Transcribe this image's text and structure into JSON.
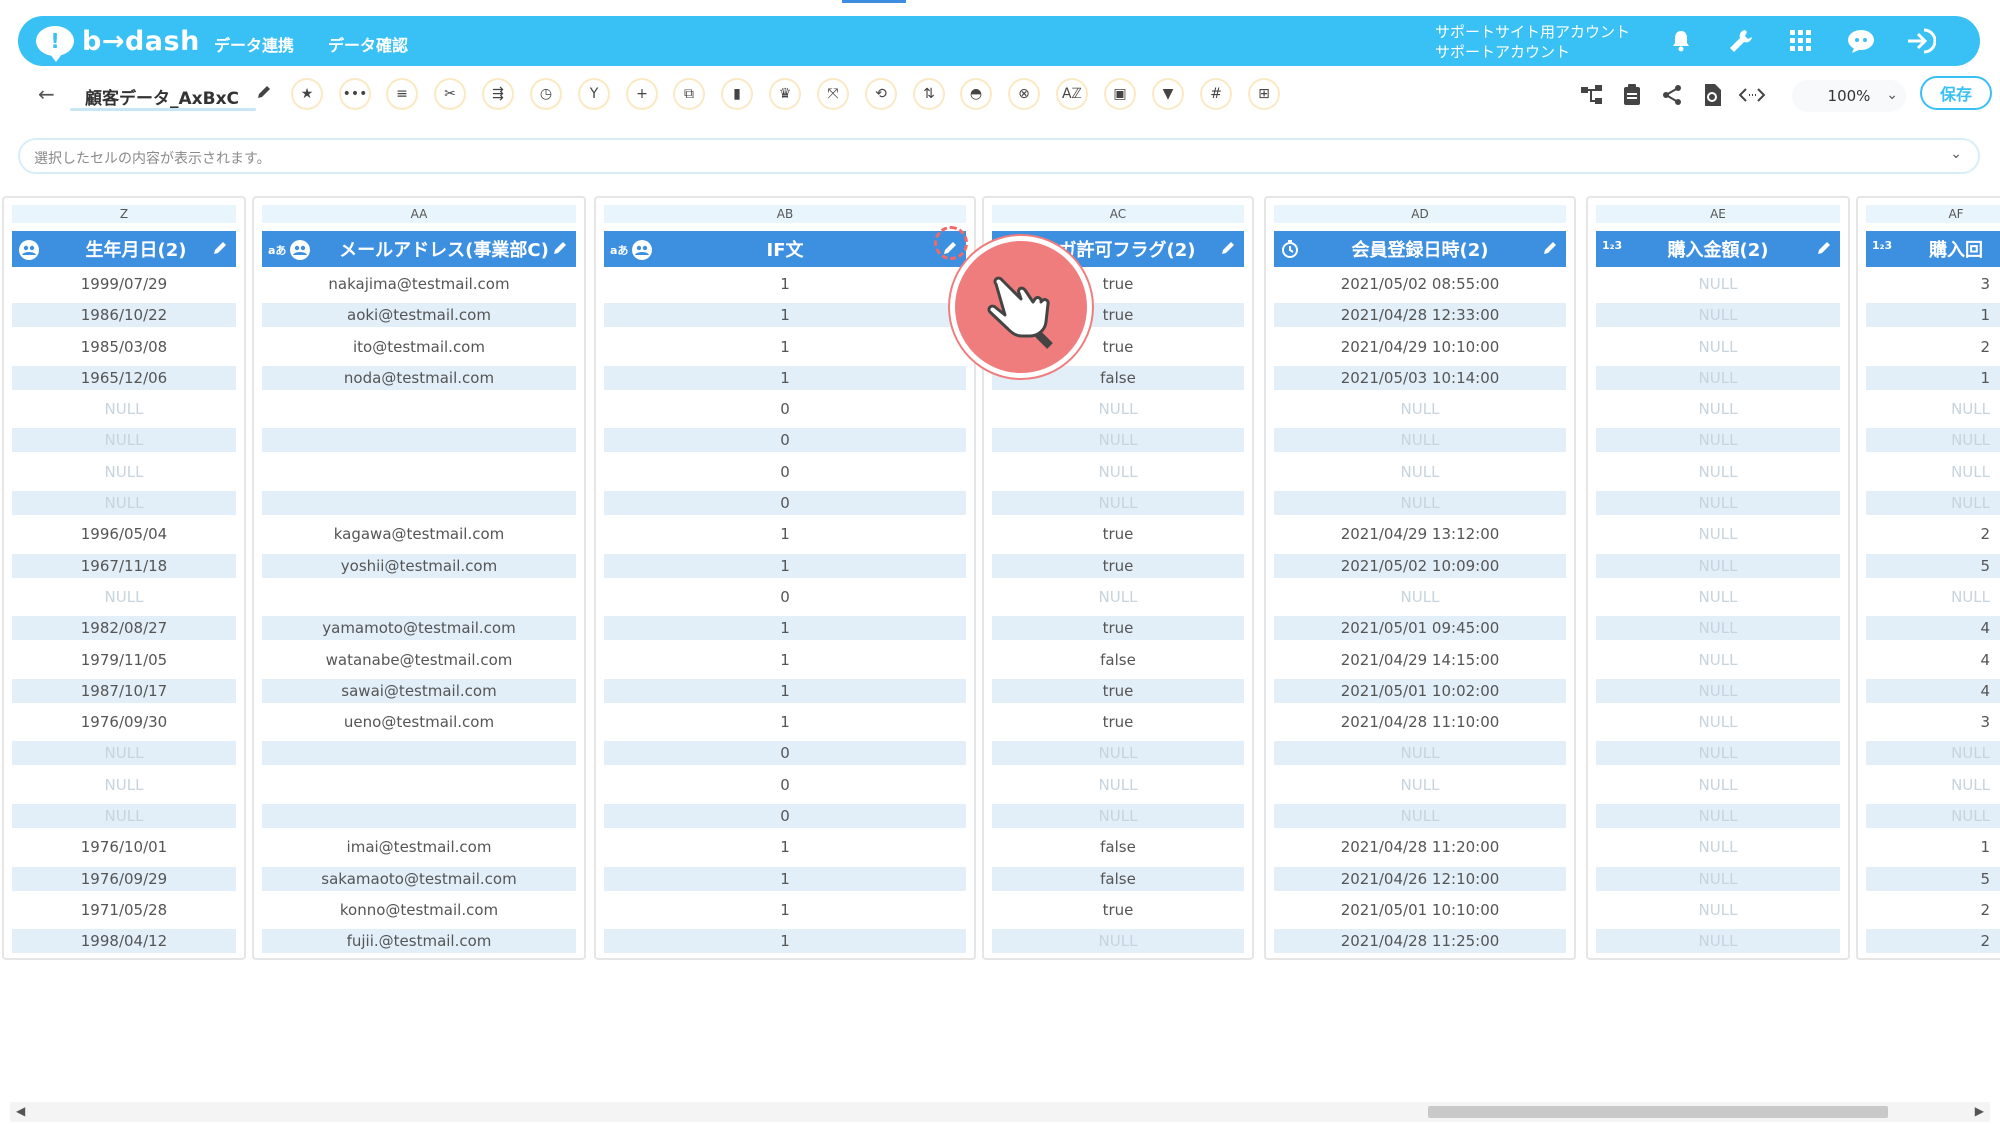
{
  "header": {
    "logo_text": "b→dash",
    "logo_mark": "!",
    "nav": [
      "データ連携",
      "データ確認"
    ],
    "account_line1": "サポートサイト用アカウント",
    "account_line2": "サポートアカウント"
  },
  "toolbar": {
    "table_name": "顧客データ_AxBxC",
    "zoom": "100%",
    "save_label": "保存"
  },
  "cellbar": {
    "placeholder": "選択したセルの内容が表示されます。"
  },
  "columns": [
    {
      "letter": "Z",
      "title": "生年月日(2)",
      "type_icon": "people-icon",
      "cells": [
        "1999/07/29",
        "1986/10/22",
        "1985/03/08",
        "1965/12/06",
        "NULL",
        "NULL",
        "NULL",
        "NULL",
        "1996/05/04",
        "1967/11/18",
        "NULL",
        "1982/08/27",
        "1979/11/05",
        "1987/10/17",
        "1976/09/30",
        "NULL",
        "NULL",
        "NULL",
        "1976/10/01",
        "1976/09/29",
        "1971/05/28",
        "1998/04/12"
      ]
    },
    {
      "letter": "AA",
      "title": "メールアドレス(事業部C)",
      "type_icon": "text-people-icon",
      "type_prefix": "aあ",
      "cells": [
        "nakajima@testmail.com",
        "aoki@testmail.com",
        "ito@testmail.com",
        "noda@testmail.com",
        "",
        "",
        "",
        "",
        "kagawa@testmail.com",
        "yoshii@testmail.com",
        "",
        "yamamoto@testmail.com",
        "watanabe@testmail.com",
        "sawai@testmail.com",
        "ueno@testmail.com",
        "",
        "",
        "",
        "imai@testmail.com",
        "sakamaoto@testmail.com",
        "konno@testmail.com",
        "fujii.@testmail.com"
      ]
    },
    {
      "letter": "AB",
      "title": "IF文",
      "type_icon": "text-people-icon",
      "type_prefix": "aあ",
      "cells": [
        "1",
        "1",
        "1",
        "1",
        "0",
        "0",
        "0",
        "0",
        "1",
        "1",
        "0",
        "1",
        "1",
        "1",
        "1",
        "0",
        "0",
        "0",
        "1",
        "1",
        "1",
        "1"
      ]
    },
    {
      "letter": "AC",
      "title": "マガ許可フラグ(2)",
      "type_icon": "",
      "cells": [
        "true",
        "true",
        "true",
        "false",
        "NULL",
        "NULL",
        "NULL",
        "NULL",
        "true",
        "true",
        "NULL",
        "true",
        "false",
        "true",
        "true",
        "NULL",
        "NULL",
        "NULL",
        "false",
        "false",
        "true",
        "NULL"
      ]
    },
    {
      "letter": "AD",
      "title": "会員登録日時(2)",
      "type_icon": "clock-icon",
      "cells": [
        "2021/05/02 08:55:00",
        "2021/04/28 12:33:00",
        "2021/04/29 10:10:00",
        "2021/05/03 10:14:00",
        "NULL",
        "NULL",
        "NULL",
        "NULL",
        "2021/04/29 13:12:00",
        "2021/05/02 10:09:00",
        "NULL",
        "2021/05/01 09:45:00",
        "2021/04/29 14:15:00",
        "2021/05/01 10:02:00",
        "2021/04/28 11:10:00",
        "NULL",
        "NULL",
        "NULL",
        "2021/04/28 11:20:00",
        "2021/04/26 12:10:00",
        "2021/05/01 10:10:00",
        "2021/04/28 11:25:00"
      ]
    },
    {
      "letter": "AE",
      "title": "購入金額(2)",
      "type_icon": "number-icon",
      "type_prefix": "1₂3",
      "cells": [
        "NULL",
        "NULL",
        "NULL",
        "NULL",
        "NULL",
        "NULL",
        "NULL",
        "NULL",
        "NULL",
        "NULL",
        "NULL",
        "NULL",
        "NULL",
        "NULL",
        "NULL",
        "NULL",
        "NULL",
        "NULL",
        "NULL",
        "NULL",
        "NULL",
        "NULL"
      ]
    },
    {
      "letter": "AF",
      "title": "購入回",
      "type_icon": "number-icon",
      "type_prefix": "1₂3",
      "cells": [
        "3",
        "1",
        "2",
        "1",
        "NULL",
        "NULL",
        "NULL",
        "NULL",
        "2",
        "5",
        "NULL",
        "4",
        "4",
        "4",
        "3",
        "NULL",
        "NULL",
        "NULL",
        "1",
        "5",
        "2",
        "2"
      ]
    }
  ]
}
